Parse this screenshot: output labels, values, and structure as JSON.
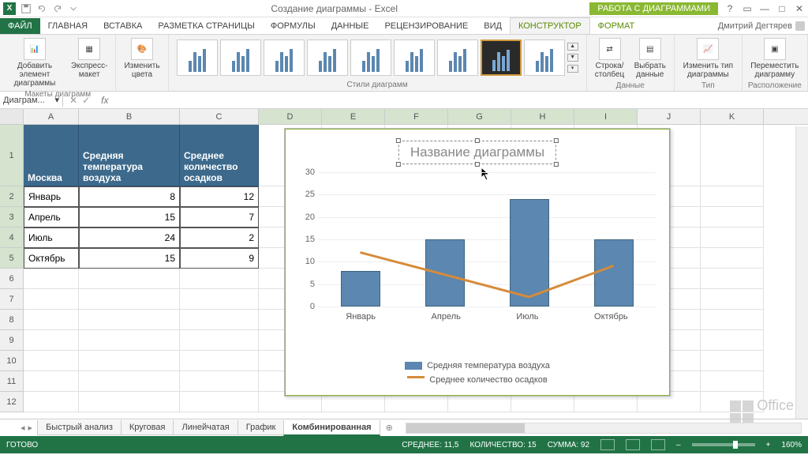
{
  "app": {
    "title": "Создание диаграммы - Excel",
    "chart_tools": "РАБОТА С ДИАГРАММАМИ",
    "user": "Дмитрий Дегтярев"
  },
  "tabs": {
    "file": "ФАЙЛ",
    "home": "ГЛАВНАЯ",
    "insert": "ВСТАВКА",
    "pagelayout": "РАЗМЕТКА СТРАНИЦЫ",
    "formulas": "ФОРМУЛЫ",
    "data": "ДАННЫЕ",
    "review": "РЕЦЕНЗИРОВАНИЕ",
    "view": "ВИД",
    "design": "КОНСТРУКТОР",
    "format": "ФОРМАТ"
  },
  "ribbon": {
    "add_element": "Добавить элемент диаграммы",
    "express": "Экспресс-макет",
    "colors": "Изменить цвета",
    "rowcol": "Строка/столбец",
    "select_data": "Выбрать данные",
    "change_type": "Изменить тип диаграммы",
    "move": "Переместить диаграмму",
    "g_layouts": "Макеты диаграмм",
    "g_styles": "Стили диаграмм",
    "g_data": "Данные",
    "g_type": "Тип",
    "g_location": "Расположение"
  },
  "namebox": "Диаграм...",
  "columns": [
    "A",
    "B",
    "C",
    "D",
    "E",
    "F",
    "G",
    "H",
    "I",
    "J",
    "K"
  ],
  "table": {
    "h0": "Москва",
    "h1": "Средняя температура воздуха",
    "h2": "Среднее количество осадков",
    "rows": [
      {
        "m": "Январь",
        "t": "8",
        "p": "12"
      },
      {
        "m": "Апрель",
        "t": "15",
        "p": "7"
      },
      {
        "m": "Июль",
        "t": "24",
        "p": "2"
      },
      {
        "m": "Октябрь",
        "t": "15",
        "p": "9"
      }
    ]
  },
  "chart_title": "Название диаграммы",
  "legend": {
    "s1": "Средняя температура воздуха",
    "s2": "Среднее количество осадков"
  },
  "chart_data": {
    "type": "combo",
    "categories": [
      "Январь",
      "Апрель",
      "Июль",
      "Октябрь"
    ],
    "series": [
      {
        "name": "Средняя температура воздуха",
        "type": "bar",
        "values": [
          8,
          15,
          24,
          15
        ]
      },
      {
        "name": "Среднее количество осадков",
        "type": "line",
        "values": [
          12,
          7,
          2,
          9
        ]
      }
    ],
    "title": "Название диаграммы",
    "ylim": [
      0,
      30
    ],
    "yticks": [
      0,
      5,
      10,
      15,
      20,
      25,
      30
    ]
  },
  "sheets": {
    "s1": "Быстрый анализ",
    "s2": "Круговая",
    "s3": "Линейчатая",
    "s4": "График",
    "s5": "Комбинированная"
  },
  "status": {
    "ready": "ГОТОВО",
    "avg": "СРЕДНЕЕ: 11,5",
    "count": "КОЛИЧЕСТВО: 15",
    "sum": "СУММА: 92",
    "zoom": "160%"
  }
}
